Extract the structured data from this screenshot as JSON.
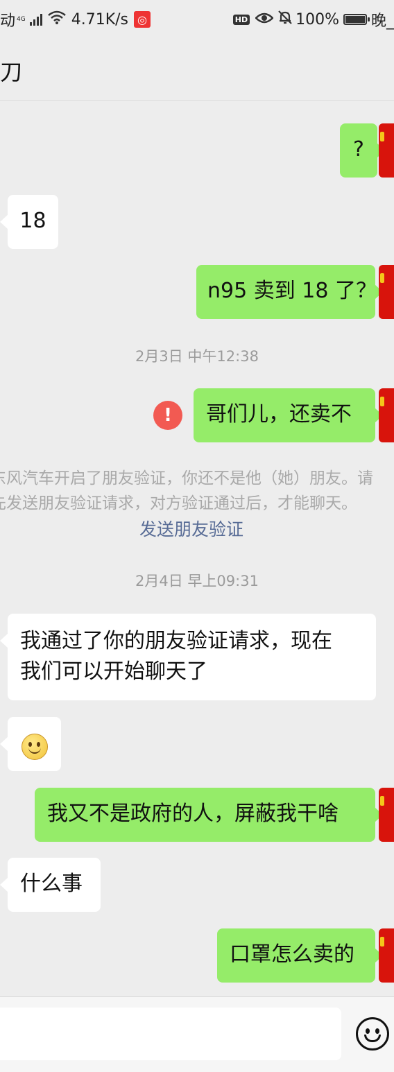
{
  "status_bar": {
    "carrier_partial": "动",
    "network": "4G",
    "speed": "4.71K/s",
    "hd_badge": "HD",
    "battery": "100%",
    "time_partial": "晚_"
  },
  "header": {
    "title": "刀"
  },
  "messages": [
    {
      "side": "out",
      "text": "?"
    },
    {
      "side": "in",
      "text": "18"
    },
    {
      "side": "out",
      "text": "n95 卖到 18 了？"
    },
    {
      "type": "time",
      "text": "2月3日 中午12:38"
    },
    {
      "side": "out",
      "text": "哥们儿，还卖不",
      "failed": true
    },
    {
      "type": "system",
      "line1": "东风汽车开启了朋友验证，你还不是他（她）朋友。请",
      "line2": "先发送朋友验证请求，对方验证通过后，才能聊天。",
      "link": "发送朋友验证"
    },
    {
      "type": "time",
      "text": "2月4日 早上09:31"
    },
    {
      "side": "in",
      "line1": "我通过了你的朋友验证请求，现在",
      "line2": "我们可以开始聊天了"
    },
    {
      "side": "in",
      "emoji": "smile"
    },
    {
      "side": "out",
      "text": "我又不是政府的人，屏蔽我干啥"
    },
    {
      "side": "in",
      "text": "什么事"
    },
    {
      "side": "out",
      "text": "口罩怎么卖的"
    }
  ],
  "error_mark": "!",
  "input": {
    "placeholder": ""
  }
}
